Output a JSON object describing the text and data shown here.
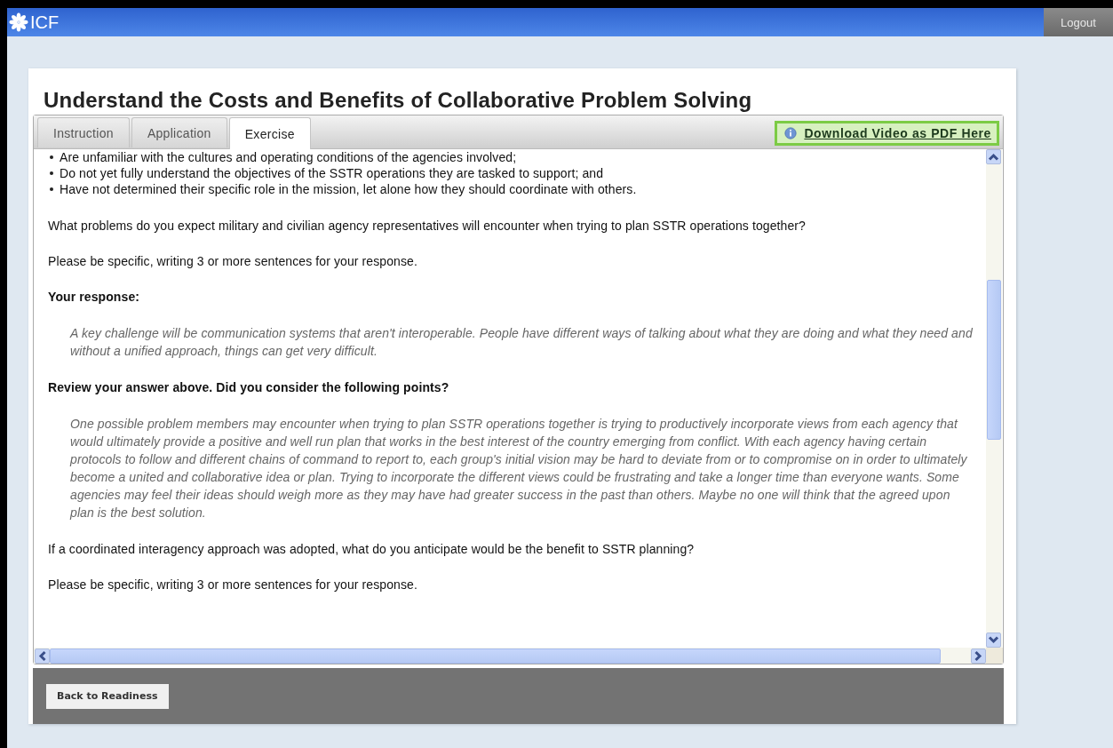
{
  "header": {
    "logo_text": "ICF",
    "logout": "Logout"
  },
  "title": "Understand the Costs and Benefits of Collaborative Problem Solving",
  "tabs": [
    {
      "label": "Instruction",
      "selected": false
    },
    {
      "label": "Application",
      "selected": false
    },
    {
      "label": "Exercise",
      "selected": true
    }
  ],
  "download_link": "Download Video as PDF Here",
  "content": [
    {
      "kind": "bullets",
      "items": [
        "Are unfamiliar with the cultures and operating conditions of the agencies involved;",
        "Do not yet fully understand the objectives of the SSTR operations they are tasked to support; and",
        "Have not determined their specific role in the mission, let alone how they should coordinate with others."
      ]
    },
    {
      "kind": "text",
      "text": "What problems do you expect military and civilian agency representatives will encounter when trying to plan SSTR operations together?"
    },
    {
      "kind": "text",
      "text": "Please be specific, writing 3 or more sentences for your response."
    },
    {
      "kind": "heading",
      "text": "Your response:"
    },
    {
      "kind": "answer",
      "text": "A key challenge will be communication systems that aren't interoperable. People have different ways of talking about what they are doing and what they need and without a unified approach, things can get very difficult."
    },
    {
      "kind": "heading",
      "text": "Review your answer above. Did you consider the following points?"
    },
    {
      "kind": "answer",
      "text": "One possible problem members may encounter when trying to plan SSTR operations together is trying to productively incorporate views from each agency that would ultimately provide a positive and well run plan that works in the best interest of the country emerging from conflict. With each agency having certain protocols to follow and different chains of command to report to, each group's initial vision may be hard to deviate from or to compromise on in order to ultimately become a united and collaborative idea or plan. Trying to incorporate the different views could be frustrating and take a longer time than everyone wants. Some agencies may feel their ideas should weigh more as they may have had greater success in the past than others. Maybe no one will think that the agreed upon plan is the best solution."
    },
    {
      "kind": "text",
      "text": "If a coordinated interagency approach was adopted, what do you anticipate would be the benefit to SSTR planning?"
    },
    {
      "kind": "text",
      "text": "Please be specific, writing 3 or more sentences for your response."
    }
  ],
  "back_button": "Back to Readiness"
}
